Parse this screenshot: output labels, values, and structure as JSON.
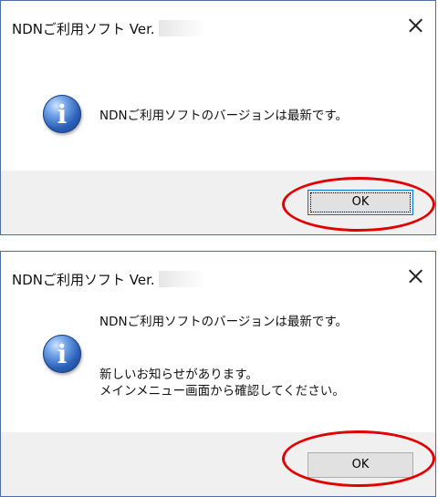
{
  "dialogs": [
    {
      "title": "NDNご利用ソフト Ver.",
      "messages": [
        "NDNご利用ソフトのバージョンは最新です。"
      ],
      "ok_label": "OK"
    },
    {
      "title": "NDNご利用ソフト Ver.",
      "messages": [
        "NDNご利用ソフトのバージョンは最新です。",
        "新しいお知らせがあります。",
        "メインメニュー画面から確認してください。"
      ],
      "ok_label": "OK"
    }
  ],
  "icon": {
    "name": "info-icon",
    "glyph": "i"
  },
  "colors": {
    "highlight": "#e00000",
    "footer": "#f0f0f0",
    "border": "#4a6ea9"
  }
}
